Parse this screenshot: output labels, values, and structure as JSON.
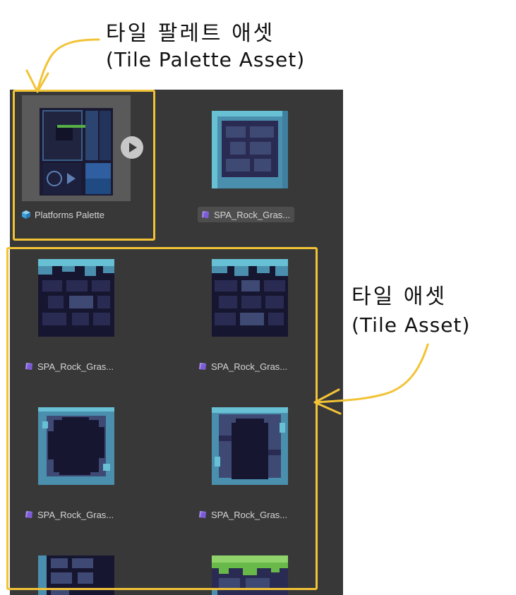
{
  "annotations": {
    "top_korean": "타일 팔레트 애셋",
    "top_english": "(Tile Palette Asset)",
    "right_korean": "타일 애셋",
    "right_english": "(Tile Asset)",
    "highlight_color": "#f2c336"
  },
  "assets": [
    {
      "label": "Platforms Palette",
      "icon": "palette-prefab-icon",
      "kind": "palette"
    },
    {
      "label": "SPA_Rock_Gras...",
      "icon": "tile-asset-icon",
      "kind": "tile",
      "selected": true,
      "art": "top-edge"
    },
    {
      "label": "SPA_Rock_Gras...",
      "icon": "tile-asset-icon",
      "kind": "tile",
      "art": "top-bricks-a"
    },
    {
      "label": "SPA_Rock_Gras...",
      "icon": "tile-asset-icon",
      "kind": "tile",
      "art": "top-bricks-b"
    },
    {
      "label": "SPA_Rock_Gras...",
      "icon": "tile-asset-icon",
      "kind": "tile",
      "art": "hole-a"
    },
    {
      "label": "SPA_Rock_Gras...",
      "icon": "tile-asset-icon",
      "kind": "tile",
      "art": "hole-b"
    },
    {
      "label": "",
      "icon": "tile-asset-icon",
      "kind": "tile",
      "art": "bricks-partial"
    },
    {
      "label": "",
      "icon": "tile-asset-icon",
      "kind": "tile",
      "art": "grass-partial"
    }
  ],
  "colors": {
    "panel_bg": "#383838",
    "tile_dark": "#171631",
    "tile_mid": "#2a2b52",
    "tile_slate": "#3e4a74",
    "tile_teal": "#4b8fae",
    "tile_light": "#67c0d3",
    "grass": "#69b94a"
  }
}
